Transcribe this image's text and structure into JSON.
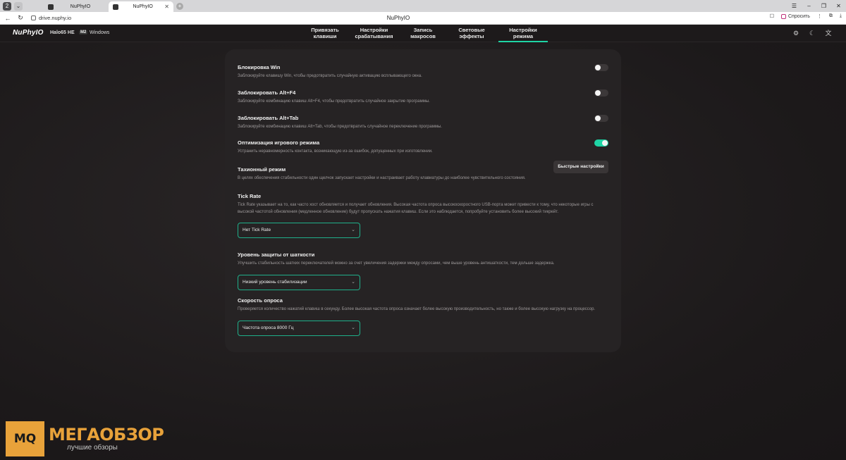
{
  "browser": {
    "tab_switcher": "2",
    "tabs": [
      {
        "label": "NuPhyIO"
      },
      {
        "label": "NuPhyIO"
      }
    ],
    "url": "drive.nuphy.io",
    "page_title": "NuPhyIO",
    "ask_label": "Спросить",
    "icons": {
      "back": "arrow-left-icon",
      "reload": "reload-icon",
      "bookmark": "bookmark-icon",
      "menu": "more-vertical-icon",
      "downloads": "download-icon"
    }
  },
  "app": {
    "logo": "NuPhyIO",
    "device_model": "Halo65 HE",
    "badge": "M2",
    "os": "Windows",
    "nav_tabs": [
      {
        "label": "Привязать\nклавиши"
      },
      {
        "label": "Настройки\nсрабатывания"
      },
      {
        "label": "Запись\nмакросов"
      },
      {
        "label": "Световые\nэффекты"
      },
      {
        "label": "Настройки\nрежима",
        "active": true
      }
    ],
    "accent_color": "#1fd4a5",
    "header_icons": [
      "settings-icon",
      "moon-icon",
      "translate-icon"
    ]
  },
  "settings": {
    "win_lock": {
      "title": "Блокировка Win",
      "desc": "Заблокируйте клавишу Win, чтобы предотвратить случайную активацию всплывающего окна.",
      "enabled": false
    },
    "alt_f4": {
      "title": "Заблокировать Alt+F4",
      "desc": "Заблокируйте комбинацию клавиш Alt+F4, чтобы предотвратить случайное закрытие программы.",
      "enabled": false
    },
    "alt_tab": {
      "title": "Заблокировать Alt+Tab",
      "desc": "Заблокируйте комбинацию клавиш Alt+Tab, чтобы предотвратить случайное переключение программы.",
      "enabled": false
    },
    "game_mode": {
      "title": "Оптимизация игрового режима",
      "desc": "Устранить неравномерность контакта, возникающую из-за ошибок, допущенных при изготовлении.",
      "enabled": true
    },
    "tachyon": {
      "title": "Тахионный режим",
      "desc": "В целях обеспечения стабильности один щелчок запускает настройки и настраивает работу клавиатуры до наиболее чувствительного состояния.",
      "button": "Быстрые настройки"
    },
    "tick_rate": {
      "title": "Tick Rate",
      "desc": "Tick Rate указывает на то, как часто хост обновляется и получает обновления. Высокая частота опроса высокоскоростного USB-порта может привести к тому, что некоторые игры с высокой частотой обновления (медленное обновление) будут пропускать нажатия клавиш. Если это наблюдается, попробуйте установить более высокий тикрейт.",
      "value": "Нет Tick Rate"
    },
    "debounce": {
      "title": "Уровень защиты от шаткости",
      "desc": "Улучшить стабильность шатких переключателей можно за счет увеличения задержки между опросами, чем выше уровень антишаткости, тем дольше задержка.",
      "value": "Низкий уровень стабилизации"
    },
    "polling": {
      "title": "Скорость опроса",
      "desc": "Проверяется количество нажатий клавиш в секунду. Более высокая частота опроса означает более высокую производительность, но также и более высокую нагрузку на процессор.",
      "value": "Частота опроса 8000 Гц"
    }
  },
  "watermark": {
    "logo": "MQ",
    "title": "МЕГАОБЗОР",
    "subtitle": "лучшие обзоры"
  }
}
